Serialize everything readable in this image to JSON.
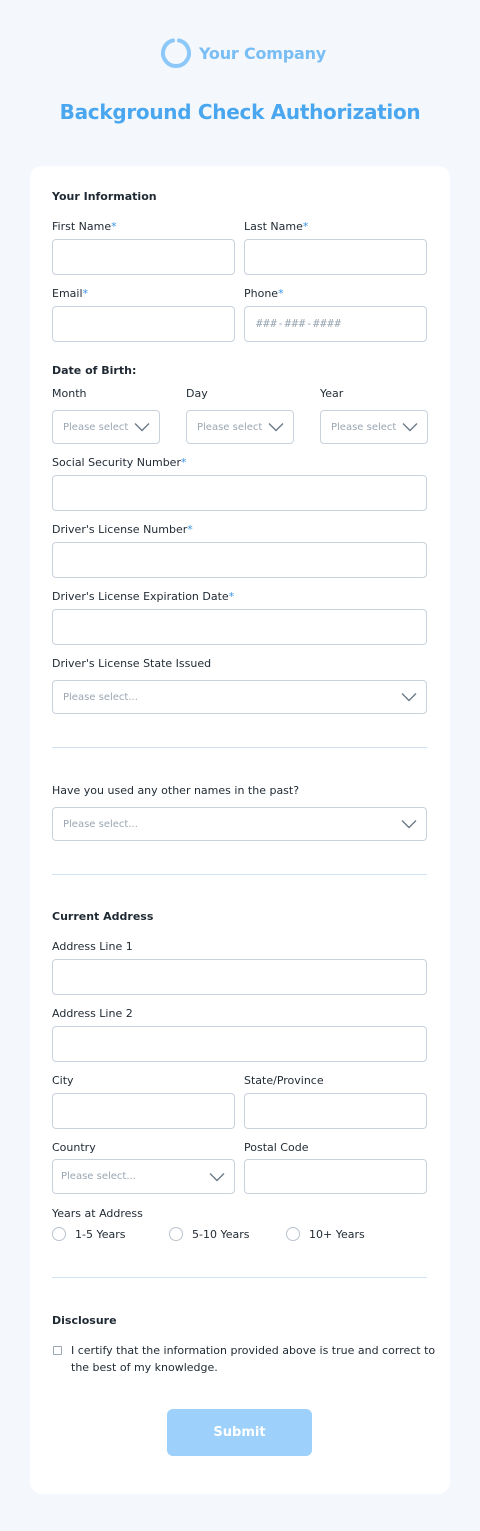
{
  "brand": {
    "name": "Your Company",
    "accent": "#4aa7ef",
    "logo_icon": "ring-logo-icon"
  },
  "page": {
    "title": "Background Check Authorization"
  },
  "your_information": {
    "title": "Your Information",
    "first_name_label": "First Name",
    "last_name_label": "Last Name",
    "email_label": "Email",
    "phone_label": "Phone",
    "phone_placeholder": "###-###-####",
    "required_mark": "*"
  },
  "dob": {
    "title": "Date of Birth:",
    "month_label": "Month",
    "day_label": "Day",
    "year_label": "Year",
    "month_placeholder": "Please select",
    "day_placeholder": "Please select",
    "year_placeholder": "Please select"
  },
  "ssn": {
    "label": "Social Security Number"
  },
  "license": {
    "number_label": "Driver's License Number",
    "expiration_label": "Driver's License Expiration Date",
    "state_label": "Driver's License State Issued",
    "state_placeholder": "Please select..."
  },
  "other_names": {
    "question": "Have you used any other names in the past?",
    "placeholder": "Please select..."
  },
  "address": {
    "title": "Current Address",
    "line1_label": "Address Line 1",
    "line2_label": "Address Line 2",
    "city_label": "City",
    "state_label": "State/Province",
    "country_label": "Country",
    "country_placeholder": "Please select...",
    "postal_label": "Postal Code",
    "years_label": "Years at Address",
    "years_options": [
      "1-5 Years",
      "5-10 Years",
      "10+ Years"
    ]
  },
  "disclosure": {
    "title": "Disclosure",
    "line1": "I certify that the information provided above is true and correct to",
    "line2": "the best of my knowledge."
  },
  "submit_label": "Submit"
}
